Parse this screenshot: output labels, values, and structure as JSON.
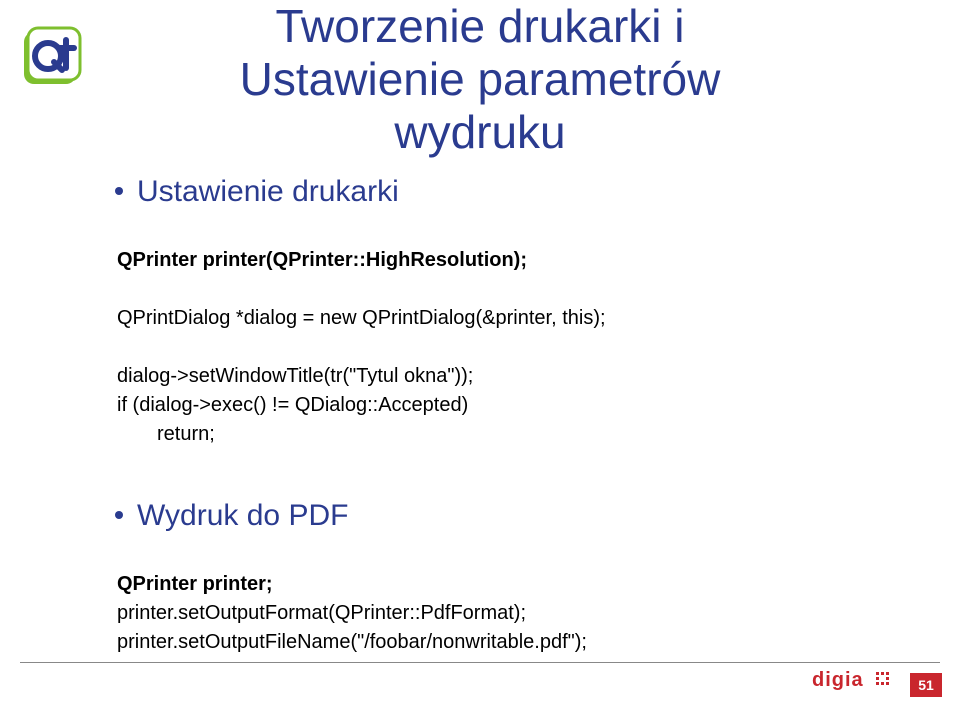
{
  "title": {
    "line1": "Tworzenie drukarki i",
    "line2": "Ustawienie parametrów",
    "line3": "wydruku"
  },
  "section1": {
    "bullet": "Ustawienie drukarki",
    "code": {
      "l1": "QPrinter printer(QPrinter::HighResolution);",
      "l2": "QPrintDialog *dialog = new QPrintDialog(&printer, this);",
      "l3": "dialog->setWindowTitle(tr(\"Tytul okna\"));",
      "l4": "if (dialog->exec() != QDialog::Accepted)",
      "l5": "return;"
    }
  },
  "section2": {
    "bullet": "Wydruk do PDF",
    "code": {
      "l1": "QPrinter printer;",
      "l2": "printer.setOutputFormat(QPrinter::PdfFormat);",
      "l3": "printer.setOutputFileName(\"/foobar/nonwritable.pdf\");"
    }
  },
  "footer": {
    "brand": "digia",
    "page": "51"
  },
  "logo": {
    "qt": "Qt"
  }
}
